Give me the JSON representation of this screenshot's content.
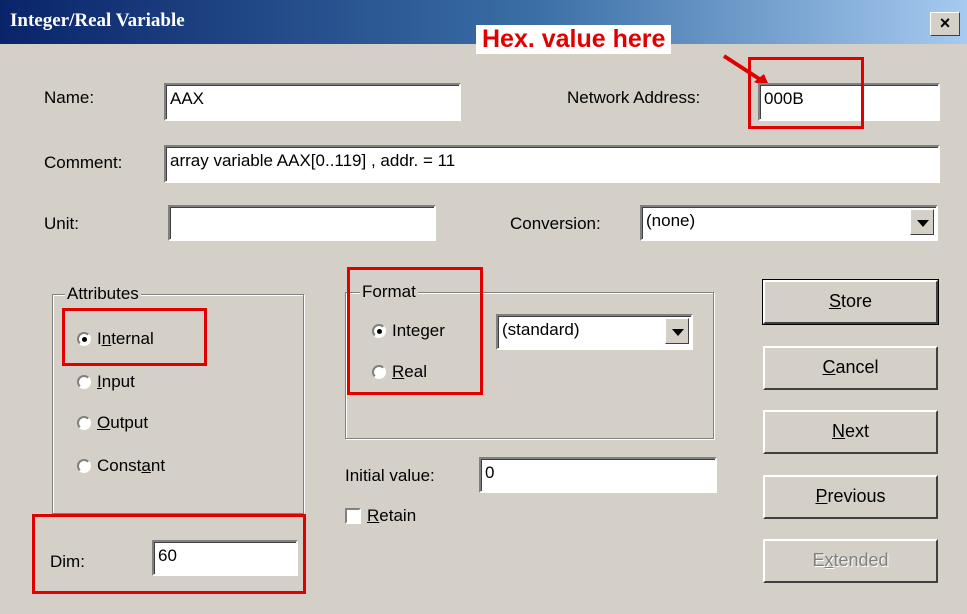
{
  "window": {
    "title": "Integer/Real Variable",
    "close_label": "×"
  },
  "annotation": {
    "callout_text": "Hex. value here"
  },
  "name": {
    "label": "Name:",
    "value": "AAX"
  },
  "network_address": {
    "label": "Network Address:",
    "value": "000B"
  },
  "comment": {
    "label": "Comment:",
    "value": "array variable  AAX[0..119] , addr. = 11"
  },
  "unit": {
    "label": "Unit:",
    "value": ""
  },
  "conversion": {
    "label": "Conversion:",
    "selected": "(none)"
  },
  "attributes": {
    "title": "Attributes",
    "options": [
      {
        "label_pre": "",
        "label_u": "",
        "label_post": "Internal",
        "checked": true
      },
      {
        "label_pre": "",
        "label_u": "I",
        "label_post": "nput",
        "checked": false
      },
      {
        "label_pre": "",
        "label_u": "O",
        "label_post": "utput",
        "checked": false
      },
      {
        "label_pre": "Const",
        "label_u": "a",
        "label_post": "nt",
        "checked": false
      }
    ]
  },
  "format": {
    "title": "Format",
    "options": [
      {
        "label": "Integer",
        "checked": true
      },
      {
        "label_u": "R",
        "label_post": "eal",
        "checked": false
      }
    ],
    "selected": "(standard)"
  },
  "initial_value": {
    "label": "Initial value:",
    "value": "0"
  },
  "retain": {
    "label_u": "R",
    "label_post": "etain",
    "checked": false
  },
  "dim": {
    "label": "Dim:",
    "value": "60"
  },
  "buttons": {
    "store_u": "S",
    "store_rest": "tore",
    "cancel_u": "C",
    "cancel_rest": "ancel",
    "next_u": "N",
    "next_rest": "ext",
    "previous_u": "P",
    "previous_rest": "revious",
    "extended_pre": "E",
    "extended_u": "x",
    "extended_rest": "tended"
  },
  "colors": {
    "highlight": "#e00000",
    "titlebar": "#0a246a",
    "dialog": "#d4d0c8"
  }
}
